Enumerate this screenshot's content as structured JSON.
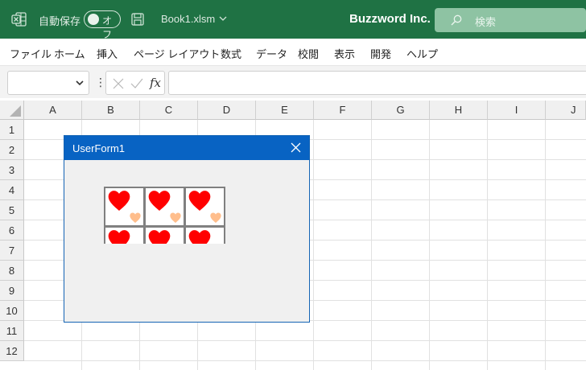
{
  "titlebar": {
    "autosave_label": "自動保存",
    "autosave_state": "オフ",
    "workbook_name": "Book1.xlsm",
    "company": "Buzzword Inc.",
    "search_placeholder": "検索",
    "accent_color": "#1f7244"
  },
  "menu": {
    "items": [
      "ファイル",
      "ホーム",
      "挿入",
      "ページ レイアウト",
      "数式",
      "データ",
      "校閲",
      "表示",
      "開発",
      "ヘルプ"
    ]
  },
  "formula_bar": {
    "namebox_value": "",
    "formula_value": "",
    "fx_label": "fx"
  },
  "sheet": {
    "columns": [
      "A",
      "B",
      "C",
      "D",
      "E",
      "F",
      "G",
      "H",
      "I",
      "J"
    ],
    "rows": [
      "1",
      "2",
      "3",
      "4",
      "5",
      "6",
      "7",
      "8",
      "9",
      "10",
      "11",
      "12"
    ]
  },
  "userform": {
    "title": "UserForm1",
    "title_color": "#0863c3",
    "tiles": [
      {
        "big_heart": "red",
        "small_heart": "peach"
      },
      {
        "big_heart": "red",
        "small_heart": "peach"
      },
      {
        "big_heart": "red",
        "small_heart": "peach"
      },
      {
        "big_heart": "red",
        "small_heart": "none"
      },
      {
        "big_heart": "red",
        "small_heart": "none"
      },
      {
        "big_heart": "red",
        "small_heart": "none"
      }
    ],
    "big_heart_color": "#ff0000",
    "small_heart_color": "#ffbe8c"
  }
}
